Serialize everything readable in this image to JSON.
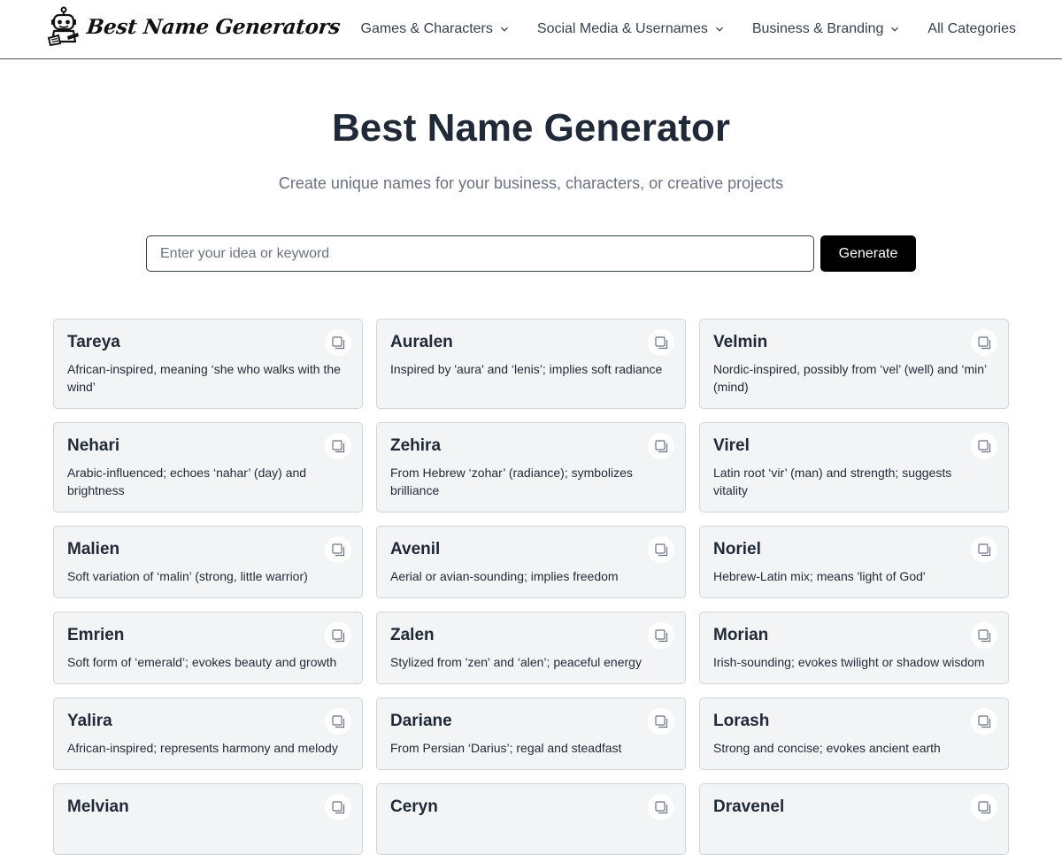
{
  "header": {
    "logo_text": "Best Name Generators",
    "nav": [
      {
        "label": "Games & Characters",
        "has_dropdown": true
      },
      {
        "label": "Social Media & Usernames",
        "has_dropdown": true
      },
      {
        "label": "Business & Branding",
        "has_dropdown": true
      },
      {
        "label": "All Categories",
        "has_dropdown": false
      }
    ]
  },
  "hero": {
    "title": "Best Name Generator",
    "subtitle": "Create unique names for your business, characters, or creative projects"
  },
  "search": {
    "placeholder": "Enter your idea or keyword",
    "value": "",
    "button_label": "Generate"
  },
  "icons": {
    "copy": "copy-icon",
    "chevron": "chevron-down-icon",
    "logo": "robot-logo-icon"
  },
  "colors": {
    "button_bg": "#000000",
    "card_bg": "#f3f4f6",
    "card_border": "#d1d5db",
    "title_text": "#1f2937",
    "subtitle_text": "#6b7280"
  },
  "cards": [
    {
      "name": "Tareya",
      "desc": "African-inspired, meaning ‘she who walks with the wind’"
    },
    {
      "name": "Auralen",
      "desc": "Inspired by 'aura' and ‘lenis’; implies soft radiance"
    },
    {
      "name": "Velmin",
      "desc": "Nordic-inspired, possibly from ‘vel’ (well) and ‘min’ (mind)"
    },
    {
      "name": "Nehari",
      "desc": "Arabic-influenced; echoes ‘nahar’ (day) and brightness"
    },
    {
      "name": "Zehira",
      "desc": "From Hebrew ‘zohar’ (radiance); symbolizes brilliance"
    },
    {
      "name": "Virel",
      "desc": "Latin root ‘vir’ (man) and strength; suggests vitality"
    },
    {
      "name": "Malien",
      "desc": "Soft variation of ‘malin’ (strong, little warrior)"
    },
    {
      "name": "Avenil",
      "desc": "Aerial or avian-sounding; implies freedom"
    },
    {
      "name": "Noriel",
      "desc": "Hebrew-Latin mix; means 'light of God'"
    },
    {
      "name": "Emrien",
      "desc": "Soft form of ‘emerald’; evokes beauty and growth"
    },
    {
      "name": "Zalen",
      "desc": "Stylized from 'zen' and ‘alen’; peaceful energy"
    },
    {
      "name": "Morian",
      "desc": "Irish-sounding; evokes twilight or shadow wisdom"
    },
    {
      "name": "Yalira",
      "desc": "African-inspired; represents harmony and melody"
    },
    {
      "name": "Dariane",
      "desc": "From Persian ‘Darius’; regal and steadfast"
    },
    {
      "name": "Lorash",
      "desc": "Strong and concise; evokes ancient earth"
    },
    {
      "name": "Melvian",
      "desc": ""
    },
    {
      "name": "Ceryn",
      "desc": ""
    },
    {
      "name": "Dravenel",
      "desc": ""
    }
  ]
}
